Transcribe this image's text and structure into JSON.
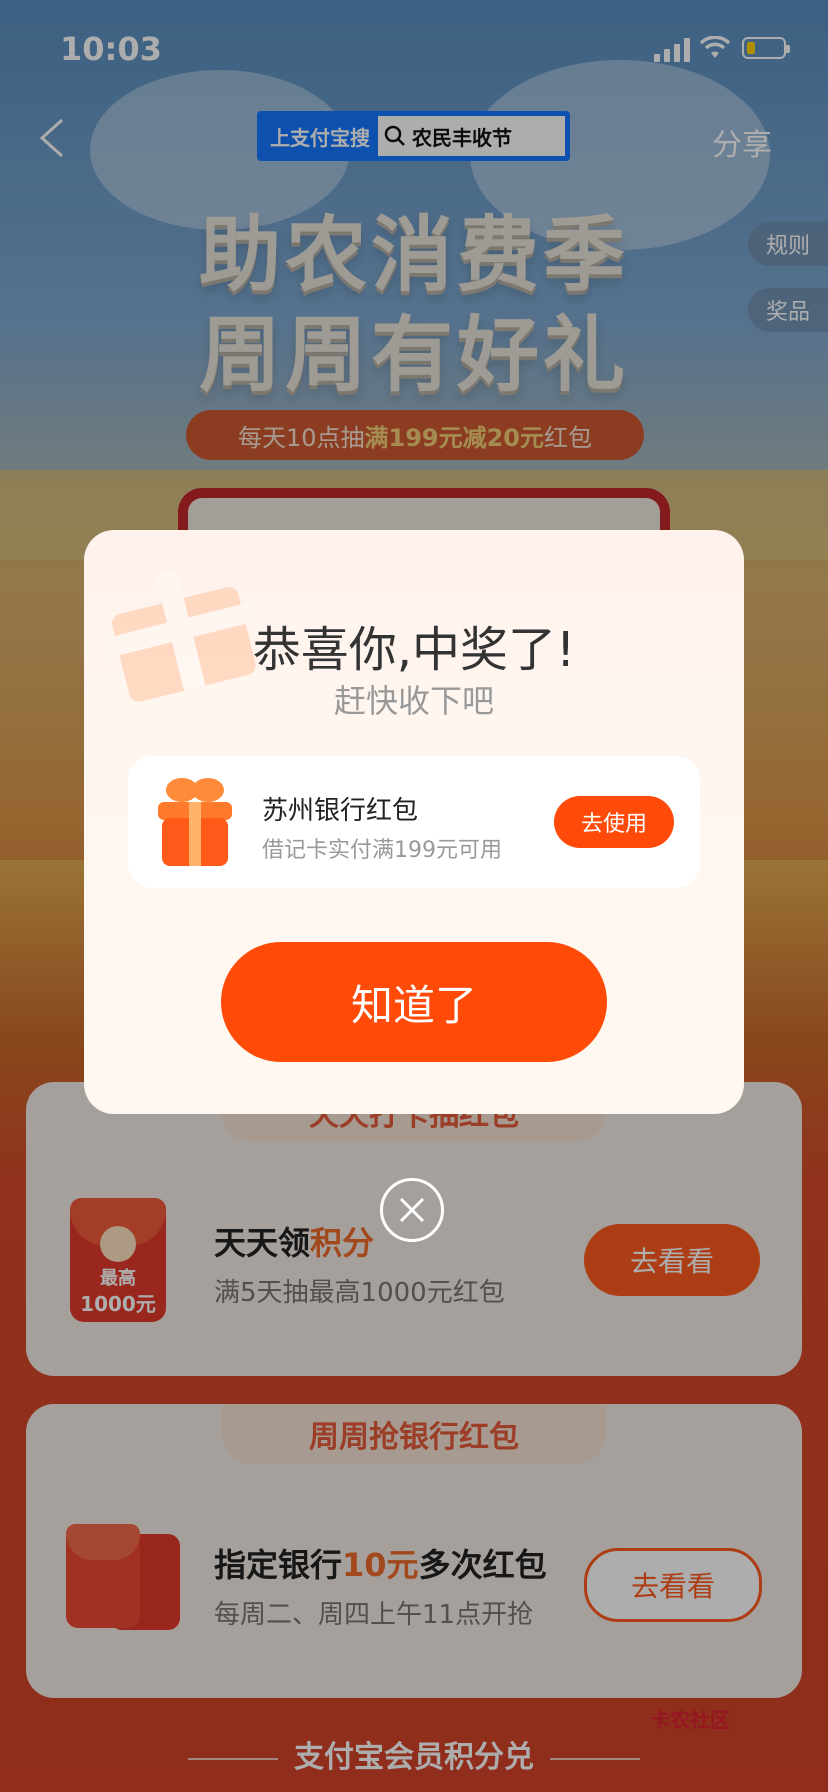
{
  "status_bar": {
    "time": "10:03"
  },
  "nav": {
    "search_tag_prefix": "上支付宝搜",
    "search_tag_keyword": "农民丰收节",
    "share_label": "分享"
  },
  "side_buttons": {
    "rules": "规则",
    "prizes": "奖品"
  },
  "hero": {
    "line1": "助农消费季",
    "line2": "周周有好礼",
    "promo_prefix": "每天10点抽",
    "promo_highlight": "满199元减20元",
    "promo_suffix": "红包"
  },
  "cards": [
    {
      "ribbon": "天天打卡抽红包",
      "title_prefix": "天天领",
      "title_highlight": "积分",
      "title_suffix": "",
      "subtitle": "满5天抽最高1000元红包",
      "envelope_line1": "最高",
      "envelope_line2": "1000元",
      "button": "去看看"
    },
    {
      "ribbon": "周周抢银行红包",
      "title_prefix": "指定银行",
      "title_highlight": "10元",
      "title_suffix": "多次红包",
      "subtitle": "每周二、周四上午11点开抢",
      "button": "去看看"
    }
  ],
  "footer": {
    "label": "支付宝会员积分兑"
  },
  "watermark": {
    "label": "卡农社区"
  },
  "dialog": {
    "heading": "恭喜你,中奖了!",
    "subheading": "赶快收下吧",
    "prize_name": "苏州银行红包",
    "prize_condition": "借记卡实付满199元可用",
    "use_button": "去使用",
    "ok_button": "知道了"
  },
  "colors": {
    "primary": "#ff4a08",
    "search_blue": "#1677ff",
    "page_red": "#d4432a"
  }
}
